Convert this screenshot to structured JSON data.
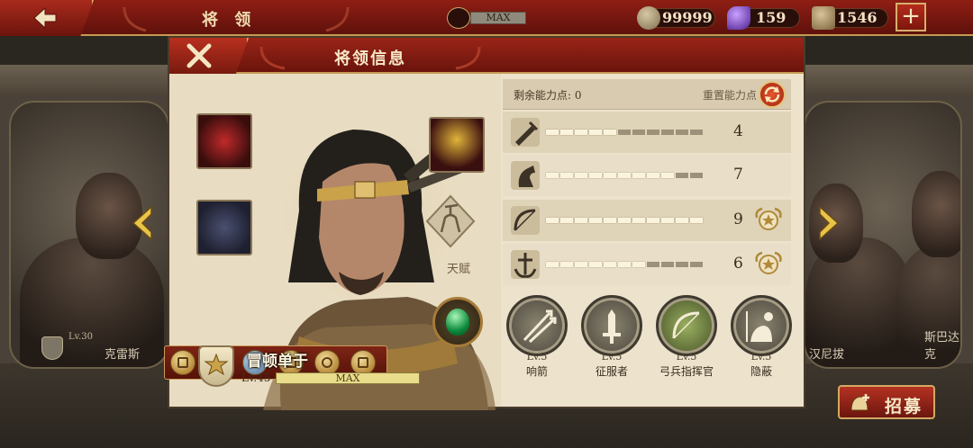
{
  "topbar": {
    "title": "将 领",
    "max_label": "MAX",
    "coins": "99999",
    "gems": "159",
    "honor": "1546",
    "plus_label": "+"
  },
  "dialog": {
    "title": "将领信息"
  },
  "hero": {
    "name": "冒顿单于",
    "level": "Lv.45",
    "exp_label": "MAX",
    "talent_label": "天赋"
  },
  "points": {
    "remaining_label": "剩余能力点: 0",
    "reset_label": "重置能力点"
  },
  "stats": [
    {
      "icon": "sword-icon",
      "value": "4",
      "filled": 5,
      "medal": false
    },
    {
      "icon": "horse-icon",
      "value": "7",
      "filled": 9,
      "medal": false
    },
    {
      "icon": "bow-icon",
      "value": "9",
      "filled": 11,
      "medal": true
    },
    {
      "icon": "anchor-icon",
      "value": "6",
      "filled": 7,
      "medal": true
    }
  ],
  "skills": [
    {
      "icon": "arrows-icon",
      "level": "Lv.5",
      "name": "响箭"
    },
    {
      "icon": "sword-icon",
      "level": "Lv.5",
      "name": "征服者"
    },
    {
      "icon": "bow-icon",
      "level": "Lv.5",
      "name": "弓兵指挥官"
    },
    {
      "icon": "stealth-icon",
      "level": "Lv.5",
      "name": "隐蔽"
    }
  ],
  "side_heroes": {
    "left_name": "克雷斯",
    "left_level": "Lv.30",
    "right_name_a": "汉尼拔",
    "right_name_b": "斯巴达克"
  },
  "recruit_label": "招募",
  "colors": {
    "accent_red": "#8e1e14",
    "gold": "#c59a52",
    "parchment": "#ede3cd"
  }
}
